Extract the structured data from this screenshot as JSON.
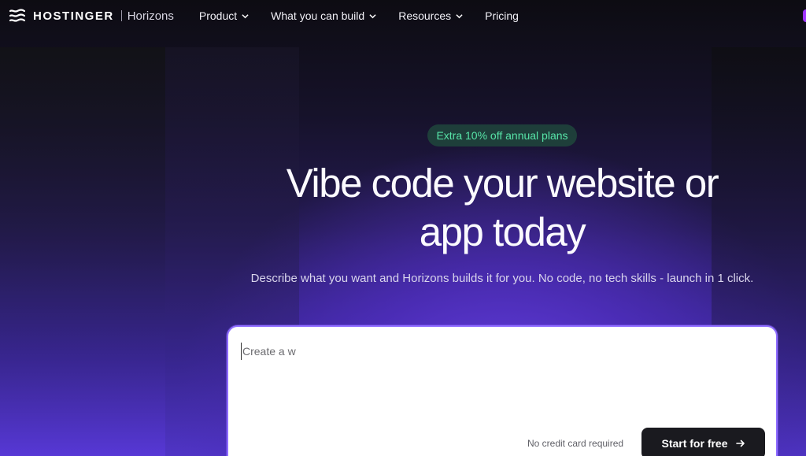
{
  "nav": {
    "brand": "HOSTINGER",
    "sub_brand": "Horizons",
    "items": [
      {
        "label": "Product",
        "has_dropdown": true
      },
      {
        "label": "What you can build",
        "has_dropdown": true
      },
      {
        "label": "Resources",
        "has_dropdown": true
      },
      {
        "label": "Pricing",
        "has_dropdown": false
      }
    ]
  },
  "hero": {
    "badge": "Extra 10% off annual plans",
    "headline_line1": "Vibe code your website or",
    "headline_line2": "app today",
    "subline": "Describe what you want and Horizons builds it for you. No code, no tech skills - launch in 1 click."
  },
  "prompt": {
    "placeholder": "Create a w",
    "value": "",
    "note": "No credit card required",
    "cta_label": "Start for free"
  },
  "colors": {
    "accent": "#8d6bff",
    "badge_text": "#57e4a8",
    "badge_bg": "#20463c",
    "button_bg": "#1a1a1f"
  },
  "icons": {
    "logo": "hostinger-logo-icon",
    "dropdown": "chevron-down-icon",
    "cta": "arrow-right-icon"
  }
}
